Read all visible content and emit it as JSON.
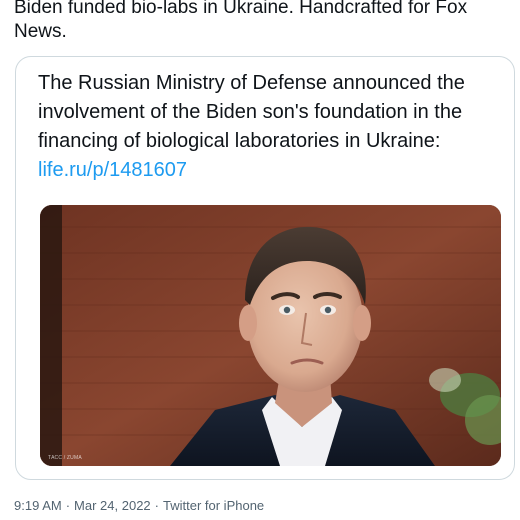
{
  "tweet": {
    "text": "Biden funded bio-labs in Ukraine. Handcrafted for Fox News."
  },
  "quoted": {
    "body": "The Russian Ministry of Defense announced the involvement of the Biden son's foundation in the financing of biological laboratories in Ukraine:",
    "link": "life.ru/p/1481607",
    "media": {
      "watermark": "ТАСС / ZUMA",
      "subject": "photo of a man in a dark suit and white shirt in front of a red brick wall"
    }
  },
  "meta": {
    "time": "9:19 AM",
    "separator": "·",
    "date": "Mar 24, 2022",
    "source": "Twitter for iPhone"
  },
  "colors": {
    "link": "#1d9bf0",
    "meta_text": "#536471",
    "card_border": "#cfd9de",
    "text": "#0f1419"
  }
}
